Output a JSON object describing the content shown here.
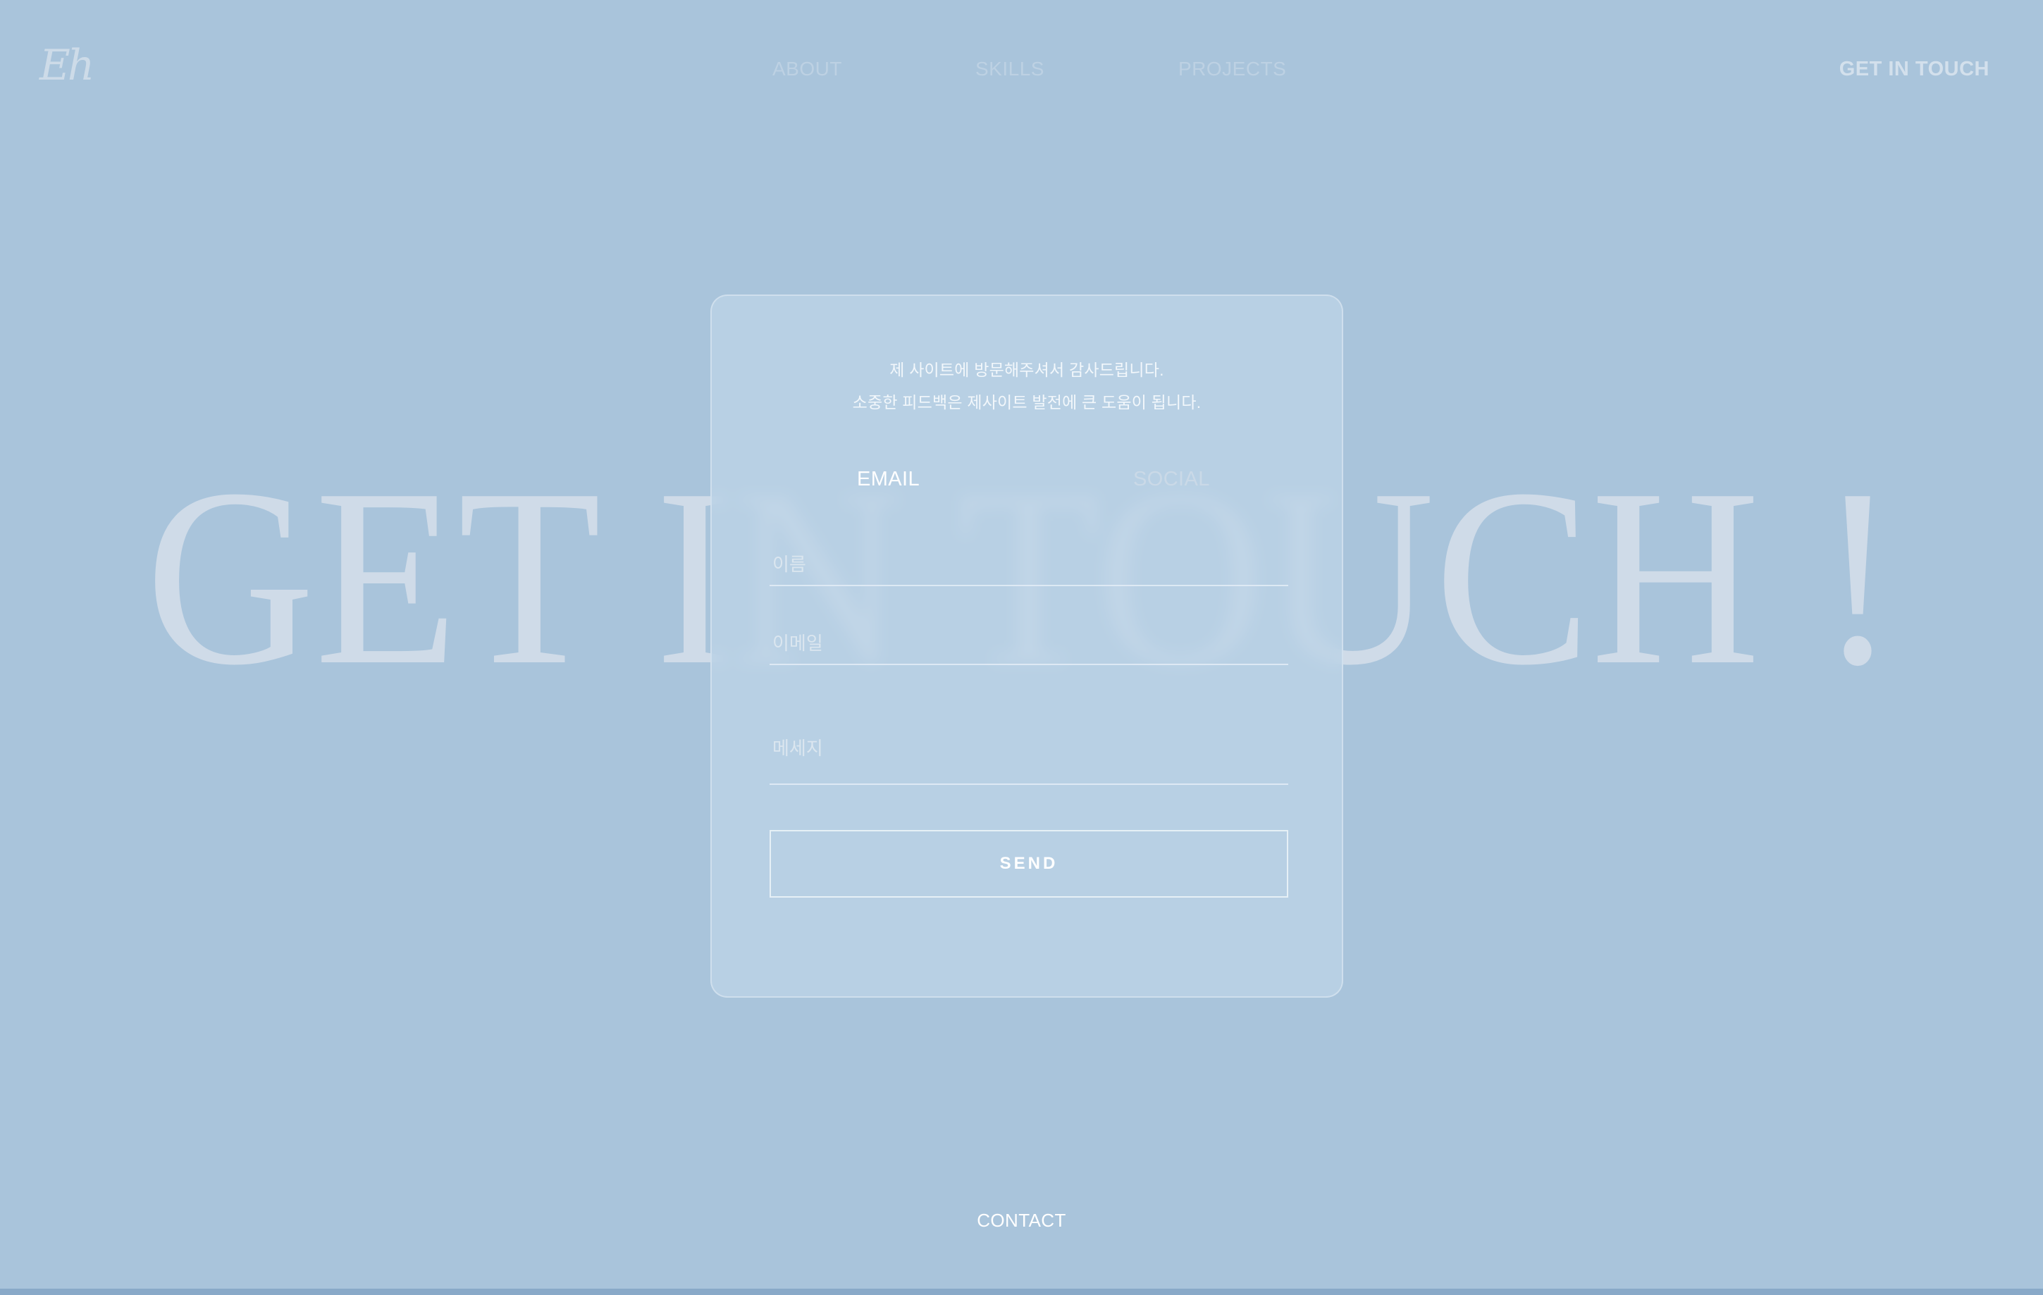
{
  "brand": {
    "logo_text": "Eh"
  },
  "nav": {
    "items": [
      {
        "label": "ABOUT"
      },
      {
        "label": "SKILLS"
      },
      {
        "label": "PROJECTS"
      }
    ],
    "cta": "GET IN TOUCH"
  },
  "hero": {
    "title": "GET IN TOUCH !"
  },
  "card": {
    "intro_line_1": "제 사이트에 방문해주셔서 감사드립니다.",
    "intro_line_2": "소중한 피드백은 제사이트 발전에 큰 도움이 됩니다.",
    "tabs": [
      {
        "label": "EMAIL"
      },
      {
        "label": "SOCIAL"
      }
    ],
    "active_tab": "EMAIL",
    "fields": {
      "name_placeholder": "이름",
      "email_placeholder": "이메일",
      "message_placeholder": "메세지"
    },
    "send_label": "SEND"
  },
  "footer": {
    "contact_label": "CONTACT"
  },
  "colors": {
    "background": "#a9c4db",
    "card": "#bcd4e7",
    "hero_text": "#cfdbe8",
    "accent_bar": "#89a9c8"
  }
}
